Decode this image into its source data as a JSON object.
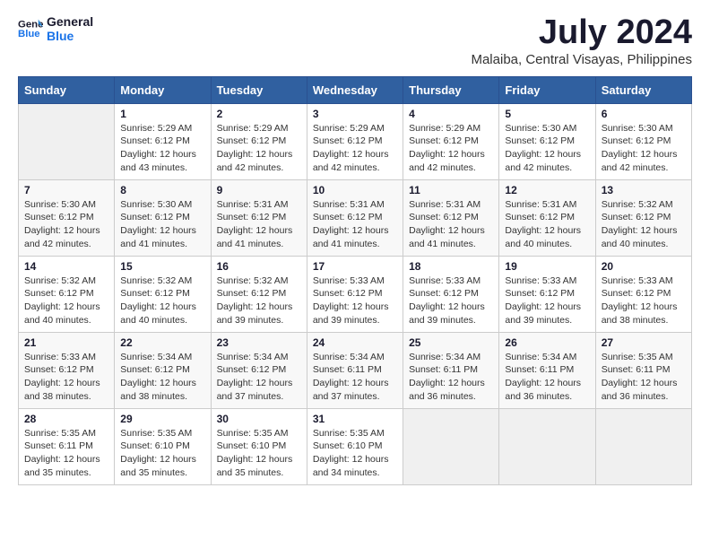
{
  "header": {
    "logo_line1": "General",
    "logo_line2": "Blue",
    "month": "July 2024",
    "location": "Malaiba, Central Visayas, Philippines"
  },
  "weekdays": [
    "Sunday",
    "Monday",
    "Tuesday",
    "Wednesday",
    "Thursday",
    "Friday",
    "Saturday"
  ],
  "weeks": [
    [
      {
        "day": "",
        "info": ""
      },
      {
        "day": "1",
        "info": "Sunrise: 5:29 AM\nSunset: 6:12 PM\nDaylight: 12 hours\nand 43 minutes."
      },
      {
        "day": "2",
        "info": "Sunrise: 5:29 AM\nSunset: 6:12 PM\nDaylight: 12 hours\nand 42 minutes."
      },
      {
        "day": "3",
        "info": "Sunrise: 5:29 AM\nSunset: 6:12 PM\nDaylight: 12 hours\nand 42 minutes."
      },
      {
        "day": "4",
        "info": "Sunrise: 5:29 AM\nSunset: 6:12 PM\nDaylight: 12 hours\nand 42 minutes."
      },
      {
        "day": "5",
        "info": "Sunrise: 5:30 AM\nSunset: 6:12 PM\nDaylight: 12 hours\nand 42 minutes."
      },
      {
        "day": "6",
        "info": "Sunrise: 5:30 AM\nSunset: 6:12 PM\nDaylight: 12 hours\nand 42 minutes."
      }
    ],
    [
      {
        "day": "7",
        "info": "Sunrise: 5:30 AM\nSunset: 6:12 PM\nDaylight: 12 hours\nand 42 minutes."
      },
      {
        "day": "8",
        "info": "Sunrise: 5:30 AM\nSunset: 6:12 PM\nDaylight: 12 hours\nand 41 minutes."
      },
      {
        "day": "9",
        "info": "Sunrise: 5:31 AM\nSunset: 6:12 PM\nDaylight: 12 hours\nand 41 minutes."
      },
      {
        "day": "10",
        "info": "Sunrise: 5:31 AM\nSunset: 6:12 PM\nDaylight: 12 hours\nand 41 minutes."
      },
      {
        "day": "11",
        "info": "Sunrise: 5:31 AM\nSunset: 6:12 PM\nDaylight: 12 hours\nand 41 minutes."
      },
      {
        "day": "12",
        "info": "Sunrise: 5:31 AM\nSunset: 6:12 PM\nDaylight: 12 hours\nand 40 minutes."
      },
      {
        "day": "13",
        "info": "Sunrise: 5:32 AM\nSunset: 6:12 PM\nDaylight: 12 hours\nand 40 minutes."
      }
    ],
    [
      {
        "day": "14",
        "info": "Sunrise: 5:32 AM\nSunset: 6:12 PM\nDaylight: 12 hours\nand 40 minutes."
      },
      {
        "day": "15",
        "info": "Sunrise: 5:32 AM\nSunset: 6:12 PM\nDaylight: 12 hours\nand 40 minutes."
      },
      {
        "day": "16",
        "info": "Sunrise: 5:32 AM\nSunset: 6:12 PM\nDaylight: 12 hours\nand 39 minutes."
      },
      {
        "day": "17",
        "info": "Sunrise: 5:33 AM\nSunset: 6:12 PM\nDaylight: 12 hours\nand 39 minutes."
      },
      {
        "day": "18",
        "info": "Sunrise: 5:33 AM\nSunset: 6:12 PM\nDaylight: 12 hours\nand 39 minutes."
      },
      {
        "day": "19",
        "info": "Sunrise: 5:33 AM\nSunset: 6:12 PM\nDaylight: 12 hours\nand 39 minutes."
      },
      {
        "day": "20",
        "info": "Sunrise: 5:33 AM\nSunset: 6:12 PM\nDaylight: 12 hours\nand 38 minutes."
      }
    ],
    [
      {
        "day": "21",
        "info": "Sunrise: 5:33 AM\nSunset: 6:12 PM\nDaylight: 12 hours\nand 38 minutes."
      },
      {
        "day": "22",
        "info": "Sunrise: 5:34 AM\nSunset: 6:12 PM\nDaylight: 12 hours\nand 38 minutes."
      },
      {
        "day": "23",
        "info": "Sunrise: 5:34 AM\nSunset: 6:12 PM\nDaylight: 12 hours\nand 37 minutes."
      },
      {
        "day": "24",
        "info": "Sunrise: 5:34 AM\nSunset: 6:11 PM\nDaylight: 12 hours\nand 37 minutes."
      },
      {
        "day": "25",
        "info": "Sunrise: 5:34 AM\nSunset: 6:11 PM\nDaylight: 12 hours\nand 36 minutes."
      },
      {
        "day": "26",
        "info": "Sunrise: 5:34 AM\nSunset: 6:11 PM\nDaylight: 12 hours\nand 36 minutes."
      },
      {
        "day": "27",
        "info": "Sunrise: 5:35 AM\nSunset: 6:11 PM\nDaylight: 12 hours\nand 36 minutes."
      }
    ],
    [
      {
        "day": "28",
        "info": "Sunrise: 5:35 AM\nSunset: 6:11 PM\nDaylight: 12 hours\nand 35 minutes."
      },
      {
        "day": "29",
        "info": "Sunrise: 5:35 AM\nSunset: 6:10 PM\nDaylight: 12 hours\nand 35 minutes."
      },
      {
        "day": "30",
        "info": "Sunrise: 5:35 AM\nSunset: 6:10 PM\nDaylight: 12 hours\nand 35 minutes."
      },
      {
        "day": "31",
        "info": "Sunrise: 5:35 AM\nSunset: 6:10 PM\nDaylight: 12 hours\nand 34 minutes."
      },
      {
        "day": "",
        "info": ""
      },
      {
        "day": "",
        "info": ""
      },
      {
        "day": "",
        "info": ""
      }
    ]
  ]
}
